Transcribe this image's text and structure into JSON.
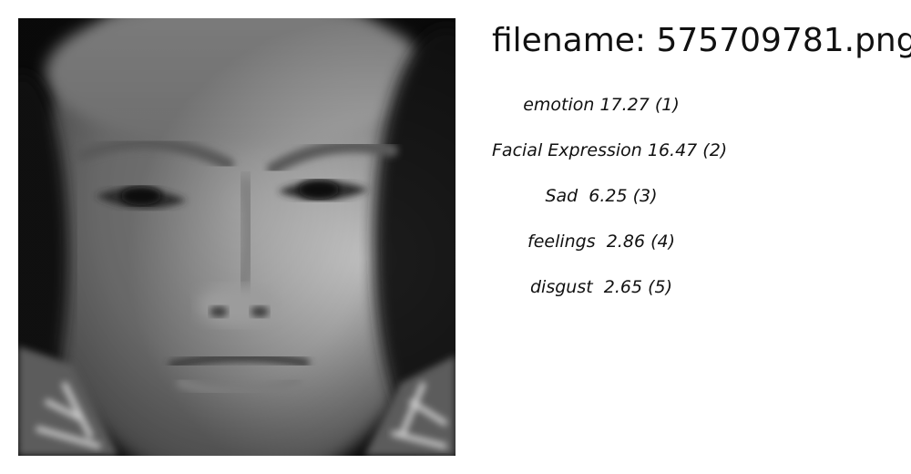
{
  "header": {
    "filename_text": "filename: 575709781.png"
  },
  "image": {
    "icon": "grayscale-face-photo"
  },
  "labels": [
    {
      "text": "emotion 17.27 (1)"
    },
    {
      "text": "Facial Expression 16.47 (2)"
    },
    {
      "text": "Sad  6.25 (3)"
    },
    {
      "text": "feelings  2.86 (4)"
    },
    {
      "text": "disgust  2.65 (5)"
    }
  ]
}
